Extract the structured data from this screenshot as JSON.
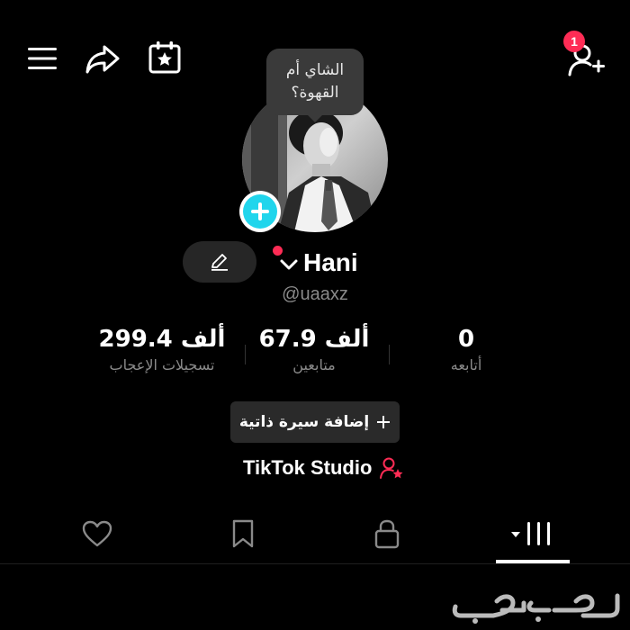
{
  "header": {
    "menu_icon": "menu-icon",
    "share_icon": "share-icon",
    "calendar_icon": "calendar-star-icon",
    "add_friend_icon": "add-user-icon",
    "notification_count": "1"
  },
  "prompt_bubble": {
    "line1": "الشاي أم",
    "line2": "القهوة؟"
  },
  "profile": {
    "name": "Hani",
    "handle": "@uaaxz",
    "avatar_icon": "avatar-photo",
    "add_icon": "plus-icon",
    "edit_icon": "pencil-icon",
    "dropdown_icon": "chevron-down-icon"
  },
  "stats": {
    "likes": {
      "value": "299.4 ألف",
      "label": "تسجيلات الإعجاب"
    },
    "followers": {
      "value": "67.9 ألف",
      "label": "متابعين"
    },
    "following": {
      "value": "0",
      "label": "أتابعه"
    }
  },
  "bio_button": {
    "label": "إضافة سيرة ذاتية",
    "icon": "plus-icon"
  },
  "studio": {
    "label": "TikTok Studio",
    "icon": "creator-star-icon"
  },
  "tabs": [
    {
      "icon": "heart-icon"
    },
    {
      "icon": "bookmark-icon"
    },
    {
      "icon": "lock-icon"
    },
    {
      "icon": "videos-grid-icon",
      "active": true
    }
  ],
  "colors": {
    "background": "#000000",
    "accent_red": "#fe2c55",
    "accent_cyan": "#20d5ec",
    "muted_text": "#8a8a8a",
    "pill_bg": "#262626"
  },
  "watermark": {
    "text": "حراج"
  }
}
